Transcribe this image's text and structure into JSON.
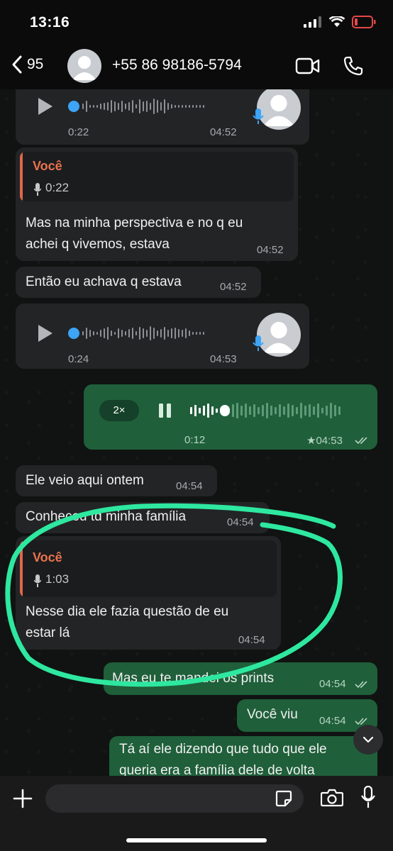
{
  "status": {
    "time": "13:16"
  },
  "header": {
    "back_count": "95",
    "contact": "+55 86 98186-5794"
  },
  "messages": {
    "voice1": {
      "elapsed": "0:22",
      "time": "04:52"
    },
    "reply1": {
      "quoted_author": "Você",
      "quoted_duration": "0:22",
      "line1": "Mas na minha perspectiva e no q eu",
      "line2": "achei q vivemos, estava",
      "time": "04:52"
    },
    "text1": {
      "text": "Então eu achava q estava",
      "time": "04:52"
    },
    "voice2": {
      "elapsed": "0:24",
      "time": "04:53"
    },
    "voice_out": {
      "speed": "2×",
      "elapsed": "0:12",
      "time": "★04:53"
    },
    "text2": {
      "text": "Ele veio aqui ontem",
      "time": "04:54"
    },
    "text3": {
      "text": "Conheceu td minha família",
      "time": "04:54"
    },
    "reply2": {
      "quoted_author": "Você",
      "quoted_duration": "1:03",
      "line1": "Nesse dia ele fazia questão de eu",
      "line2": "estar lá",
      "time": "04:54"
    },
    "out1": {
      "text": "Mas eu te mandei os prints",
      "time": "04:54"
    },
    "out2": {
      "text": "Você viu",
      "time": "04:54"
    },
    "out3": {
      "line1": "Tá aí ele dizendo que tudo que ele",
      "line2": "queria era a família dele de volta"
    }
  },
  "colors": {
    "incoming": "#232426",
    "outgoing": "#1f5f3a",
    "highlight": "#2ee8a0",
    "quote_author": "#e8734f"
  }
}
